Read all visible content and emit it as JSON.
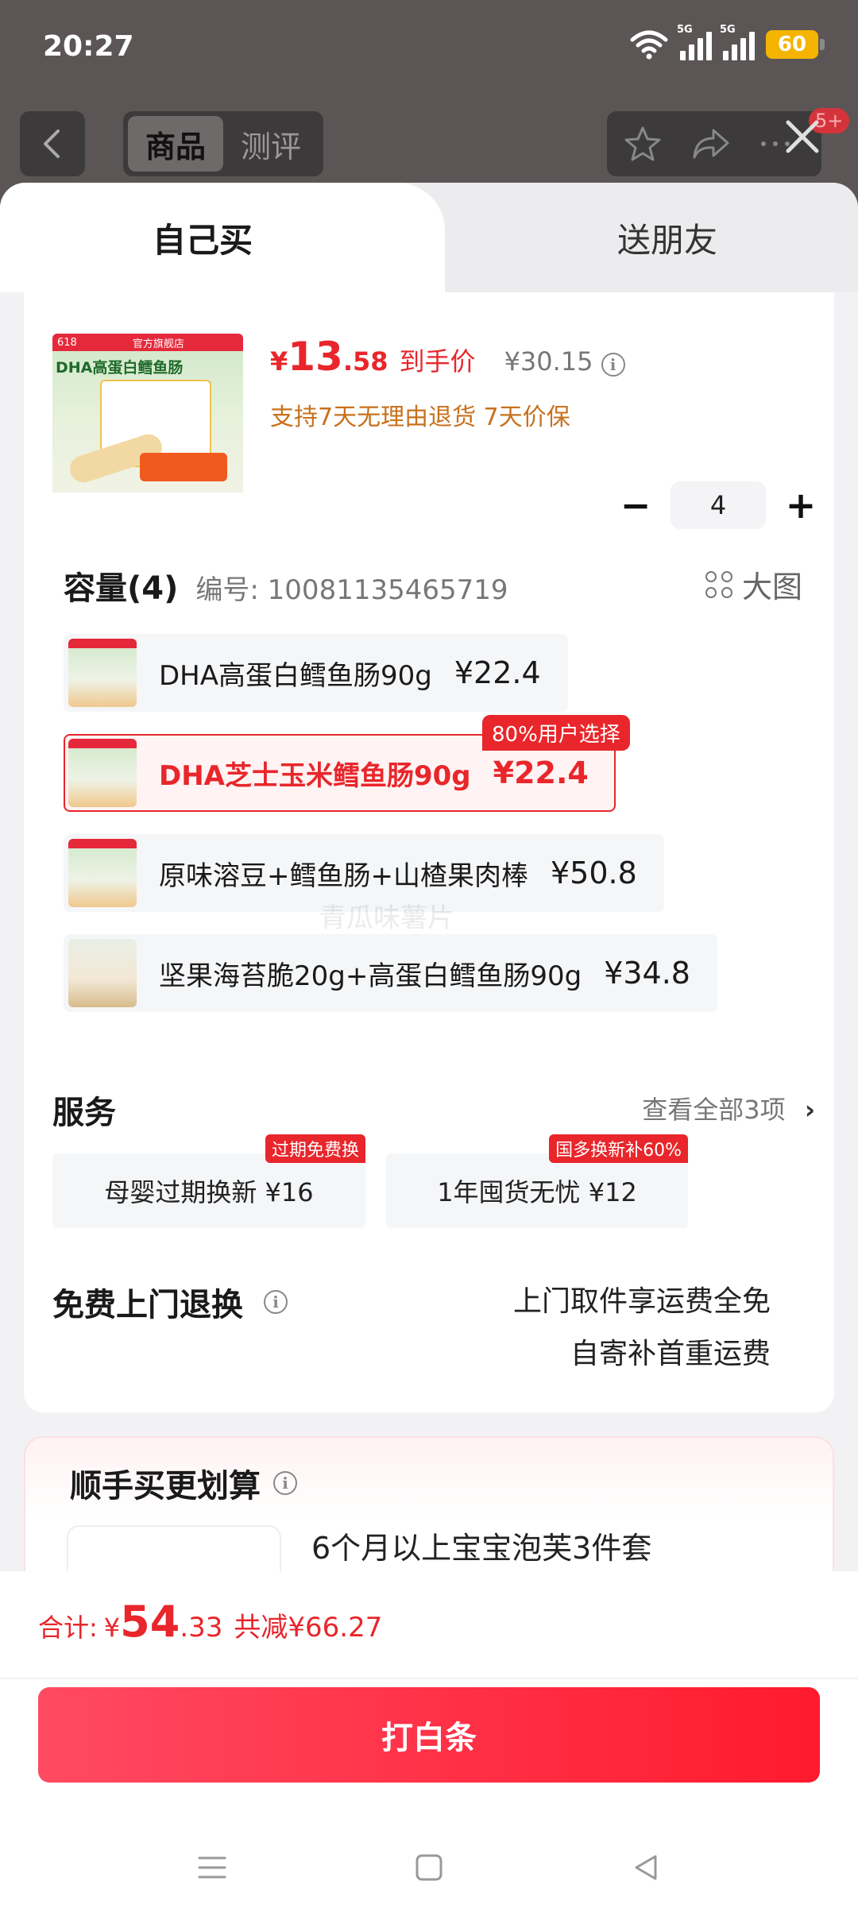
{
  "status": {
    "time": "20:27",
    "network1": "5G",
    "network2": "5G",
    "battery": "60"
  },
  "nav": {
    "tabs": [
      "商品",
      "测评"
    ],
    "badge": "5+"
  },
  "purchase_modes": {
    "self": "自己买",
    "friend": "送朋友"
  },
  "product": {
    "image_ribbon_left": "618",
    "image_ribbon_right": "官方旗舰店",
    "image_title": "DHA高蛋白鳕鱼肠",
    "price_currency": "¥",
    "price_int": "13",
    "price_dec": ".58",
    "price_label": "到手价",
    "original_price": "¥30.15",
    "guarantee": "支持7天无理由退货 7天价保",
    "quantity": "4"
  },
  "spec": {
    "title": "容量(4)",
    "code": "编号: 10081135465719",
    "big_image_label": "大图",
    "options": [
      {
        "name": "DHA高蛋白鳕鱼肠90g",
        "price": "¥22.4"
      },
      {
        "name": "DHA芝士玉米鳕鱼肠90g",
        "price": "¥22.4",
        "tag": "80%用户选择"
      },
      {
        "name": "原味溶豆+鳕鱼肠+山楂果肉棒",
        "price": "¥50.8"
      },
      {
        "name": "坚果海苔脆20g+高蛋白鳕鱼肠90g",
        "price": "¥34.8"
      }
    ]
  },
  "watermark": "青瓜味薯片",
  "services": {
    "title": "服务",
    "more": "查看全部3项",
    "items": [
      {
        "label": "母婴过期换新 ¥16",
        "tag": "过期免费换"
      },
      {
        "label": "1年囤货无忧 ¥12",
        "tag": "国多换新补60%"
      }
    ]
  },
  "return_service": {
    "title": "免费上门退换",
    "line1": "上门取件享运费全免",
    "line2": "自寄补首重运费"
  },
  "addon": {
    "title": "顺手买更划算",
    "item_name": "6个月以上宝宝泡芙3件套"
  },
  "footer": {
    "total_label": "合计:",
    "total_currency": "¥",
    "total_int": "54",
    "total_dec": ".33",
    "saving": "共减¥66.27",
    "pay_button": "打白条"
  },
  "colors": {
    "accent": "#e8262b",
    "guarantee": "#c7711d",
    "button_start": "#ff4a62",
    "button_end": "#ff1a2e"
  }
}
